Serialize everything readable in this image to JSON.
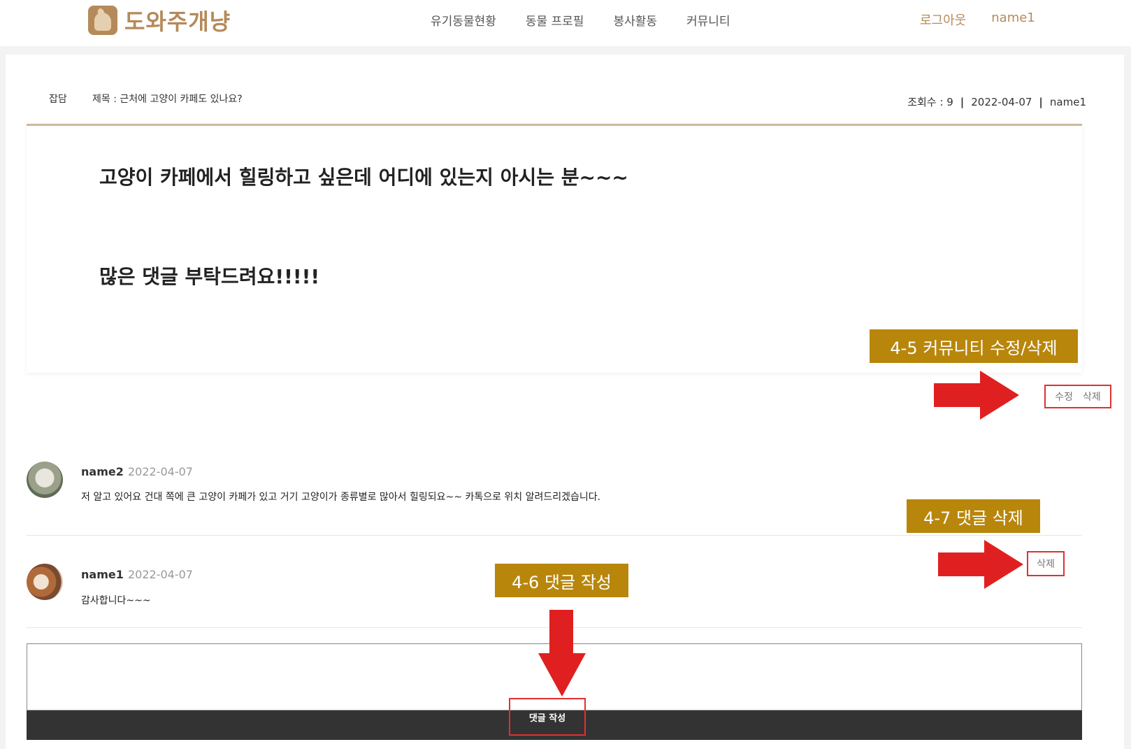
{
  "header": {
    "logo_text": "도와주개냥",
    "nav": [
      "유기동물현황",
      "동물 프로필",
      "봉사활동",
      "커뮤니티"
    ],
    "logout_label": "로그아웃",
    "username": "name1"
  },
  "post": {
    "category": "잡담",
    "title": "제목 : 근처에 고양이 카페도 있나요?",
    "views": "조회수 : 9",
    "date": "2022-04-07",
    "author": "name1",
    "content_line1": "고양이 카페에서 힐링하고 싶은데 어디에 있는지 아시는 분~~~",
    "content_line2": "많은 댓글 부탁드려요!!!!!",
    "edit_label": "수정",
    "delete_label": "삭제"
  },
  "comments": [
    {
      "author": "name2",
      "date": "2022-04-07",
      "text": "저 알고 있어요 건대 쪽에 큰 고양이 카페가 있고 거기 고양이가 종류별로 많아서 힐링되요~~ 카톡으로 위치 알려드리겠습니다."
    },
    {
      "author": "name1",
      "date": "2022-04-07",
      "text": "감사합니다~~~",
      "delete_label": "삭제"
    }
  ],
  "comment_form": {
    "placeholder": "",
    "submit_label": "댓글 작성"
  },
  "annotations": {
    "edit_delete_post": "4-5 커뮤니티 수정/삭제",
    "delete_comment": "4-7 댓글 삭제",
    "write_comment": "4-6 댓글 작성"
  },
  "colors": {
    "brand": "#b58a5a",
    "annotation_bg": "#b8860b",
    "highlight_border": "#e03030",
    "arrow": "#e02020",
    "submit_bar": "#333333"
  }
}
